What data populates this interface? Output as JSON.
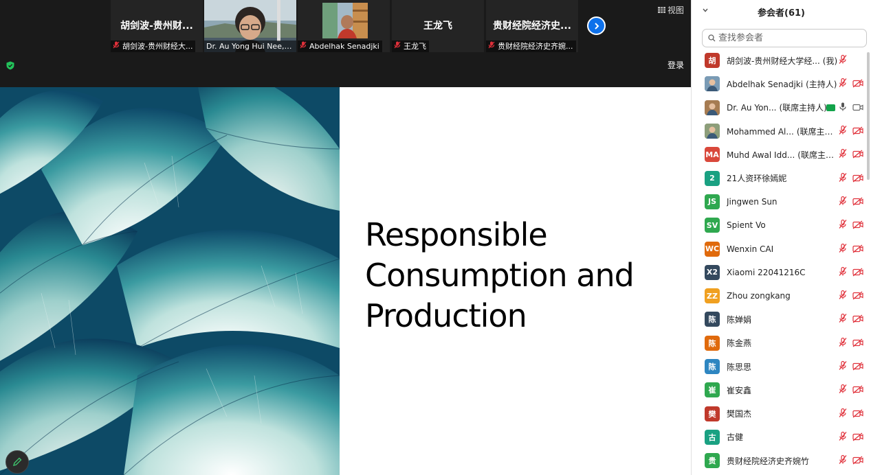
{
  "topbar": {
    "tiles": [
      {
        "name": "胡剑波-贵州财...",
        "caption": "胡剑波-贵州财经大..."
      },
      {
        "name": "",
        "caption": "Dr. Au Yong Hui Nee, UT..."
      },
      {
        "name": "",
        "caption": "Abdelhak Senadjki"
      },
      {
        "name": "王龙飞",
        "caption": "王龙飞"
      },
      {
        "name": "贵财经院经济史...",
        "caption": "贵财经院经济史齐婉..."
      }
    ],
    "view_label": "视图",
    "login_label": "登录"
  },
  "slide": {
    "title": "Responsible Consumption and Production"
  },
  "panel": {
    "title": "参会者(61)",
    "search_placeholder": "查找参会者",
    "participants": [
      {
        "avatar": "胡",
        "color": "#c0392b",
        "name": "胡剑波-贵州财经大学经...",
        "role": "(我)"
      },
      {
        "avatar": "",
        "color": "#7a9bb5",
        "name": "Abdelhak Senadjki",
        "role": "(主持人)"
      },
      {
        "avatar": "",
        "color": "#a67c52",
        "name": "Dr. Au Yon...",
        "role": "(联席主持人)"
      },
      {
        "avatar": "",
        "color": "#8d9e7a",
        "name": "Mohammed Al...",
        "role": "(联席主持人)"
      },
      {
        "avatar": "MA",
        "color": "#d9483b",
        "name": "Muhd Awal Idd...",
        "role": "(联席主持人)"
      },
      {
        "avatar": "2",
        "color": "#1aa182",
        "name": "21人资环徐嫣妮",
        "role": ""
      },
      {
        "avatar": "JS",
        "color": "#2fa84f",
        "name": "Jingwen Sun",
        "role": ""
      },
      {
        "avatar": "SV",
        "color": "#2fa84f",
        "name": "Spient Vo",
        "role": ""
      },
      {
        "avatar": "WC",
        "color": "#e06a0c",
        "name": "Wenxin CAI",
        "role": ""
      },
      {
        "avatar": "X2",
        "color": "#34495e",
        "name": "Xiaomi 22041216C",
        "role": ""
      },
      {
        "avatar": "ZZ",
        "color": "#f0a020",
        "name": "Zhou zongkang",
        "role": ""
      },
      {
        "avatar": "陈",
        "color": "#34495e",
        "name": "陈婵娟",
        "role": ""
      },
      {
        "avatar": "陈",
        "color": "#e06a0c",
        "name": "陈金燕",
        "role": ""
      },
      {
        "avatar": "陈",
        "color": "#2e86c1",
        "name": "陈思思",
        "role": ""
      },
      {
        "avatar": "崔",
        "color": "#2fa84f",
        "name": "崔安鑫",
        "role": ""
      },
      {
        "avatar": "樊",
        "color": "#c0392b",
        "name": "樊国杰",
        "role": ""
      },
      {
        "avatar": "古",
        "color": "#1aa182",
        "name": "古健",
        "role": ""
      },
      {
        "avatar": "贵",
        "color": "#2fa84f",
        "name": "贵财经院经济史齐婉竹",
        "role": ""
      }
    ]
  },
  "colors": {
    "accent": "#0e71eb",
    "muted_red": "#e0303a"
  }
}
